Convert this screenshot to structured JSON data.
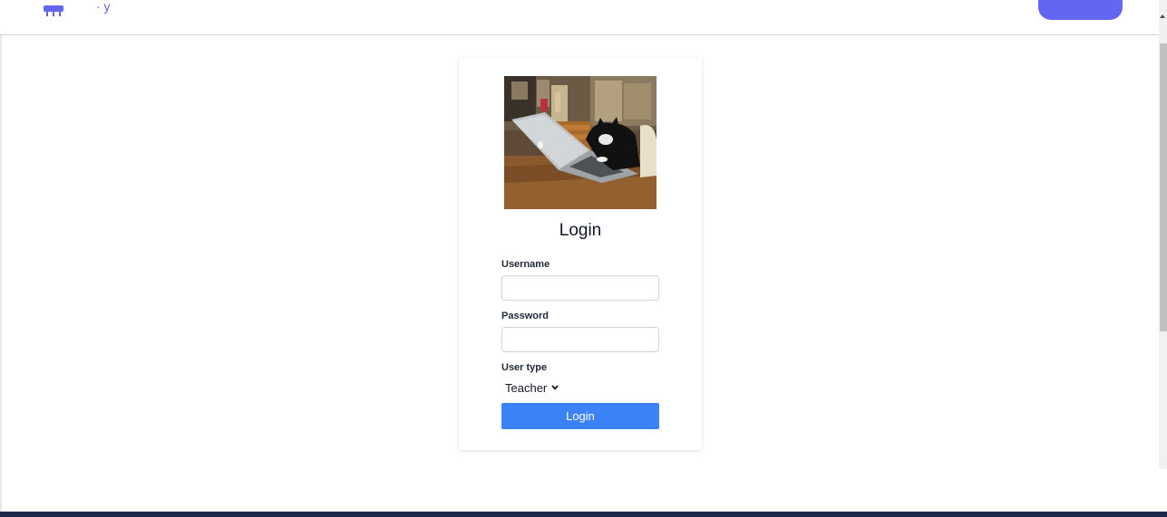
{
  "navbar": {
    "brand_text": "·  y",
    "brand_icon": "logo-icon",
    "action_button_label": "",
    "accent_color": "#6366f1"
  },
  "login": {
    "image": "photo of a cat at a laptop",
    "title": "Login",
    "username_label": "Username",
    "username_value": "",
    "password_label": "Password",
    "password_value": "",
    "user_type_label": "User type",
    "user_type_selected": "Teacher",
    "submit_label": "Login",
    "button_color": "#3b82f6"
  },
  "footer": {
    "color": "#1e2a4a"
  }
}
